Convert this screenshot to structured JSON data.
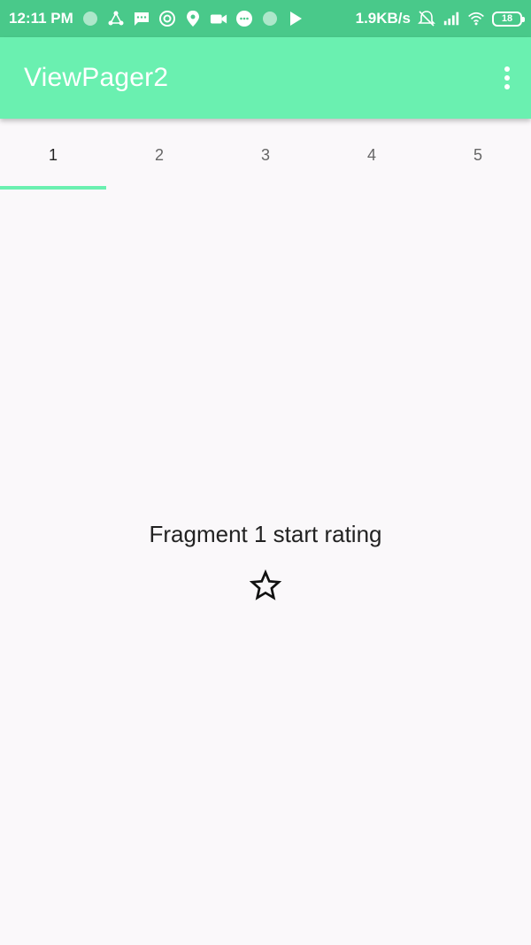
{
  "status_bar": {
    "time": "12:11 PM",
    "net_speed": "1.9KB/s",
    "battery_level": "18",
    "icons": [
      "circle-icon",
      "share-icon",
      "message-icon",
      "settings-icon",
      "location-icon",
      "video-icon",
      "chat-icon",
      "circle-icon",
      "play-store-icon",
      "alarm-off-icon",
      "signal-icon",
      "wifi-icon",
      "battery-icon"
    ]
  },
  "app_bar": {
    "title": "ViewPager2",
    "menu_icon": "more-vert-icon"
  },
  "tabs": [
    {
      "label": "1",
      "selected": true
    },
    {
      "label": "2",
      "selected": false
    },
    {
      "label": "3",
      "selected": false
    },
    {
      "label": "4",
      "selected": false
    },
    {
      "label": "5",
      "selected": false
    }
  ],
  "fragment": {
    "title": "Fragment 1 start rating",
    "rating_icon": "star-outline-icon"
  },
  "colors": {
    "status_bar": "#49c98a",
    "app_bar": "#6af0b0",
    "tab_indicator": "#6af0b0",
    "background": "#faf8fa"
  }
}
